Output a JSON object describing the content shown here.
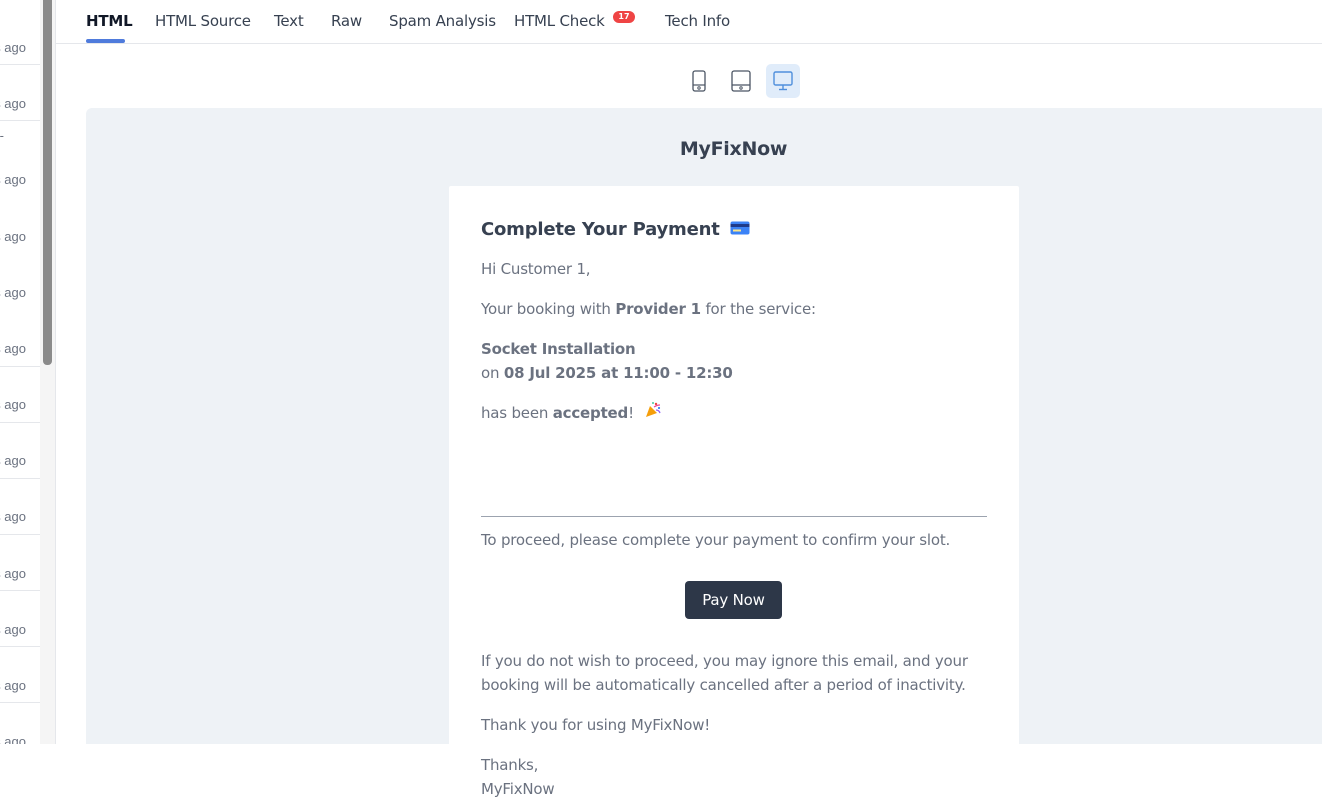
{
  "left_list": {
    "items": [
      "s ago",
      "s ago",
      "-",
      "s ago",
      "s ago",
      "s ago",
      "s ago",
      "s ago",
      "s ago",
      "s ago",
      "s ago",
      "s ago",
      "s ago",
      "s ago"
    ]
  },
  "tabs": [
    {
      "label": "HTML",
      "active": true
    },
    {
      "label": "HTML Source"
    },
    {
      "label": "Text"
    },
    {
      "label": "Raw"
    },
    {
      "label": "Spam Analysis"
    },
    {
      "label": "HTML Check"
    },
    {
      "label": "Tech Info"
    }
  ],
  "html_check_badge": "17",
  "devices": {
    "mobile_icon": "mobile-icon",
    "tablet_icon": "tablet-icon",
    "desktop_icon": "desktop-icon",
    "active": "desktop"
  },
  "email": {
    "brand": "MyFixNow",
    "title": "Complete Your Payment",
    "title_emoji": "credit-card-icon",
    "greeting": "Hi Customer 1,",
    "booking_prefix": "Your booking with ",
    "provider": "Provider 1",
    "booking_suffix": " for the service:",
    "service": "Socket Installation",
    "on_prefix": "on ",
    "datetime": "08 Jul 2025 at 11:00 - 12:30",
    "status_prefix": "has been ",
    "status": "accepted",
    "status_suffix": "!",
    "status_emoji": "party-popper-icon",
    "proceed_text": "To proceed, please complete your payment to confirm your slot.",
    "pay_button": "Pay Now",
    "ignore_line1": "If you do not wish to proceed, you may ignore this email, and your",
    "ignore_line2": "booking will be automatically cancelled after a period of inactivity.",
    "thanks_using": "Thank you for using MyFixNow!",
    "signoff": "Thanks,",
    "signature": "MyFixNow"
  },
  "colors": {
    "accent": "#4f7bdc",
    "badge": "#ef4444",
    "button": "#2d3748",
    "preview_bg": "#eef2f6"
  }
}
